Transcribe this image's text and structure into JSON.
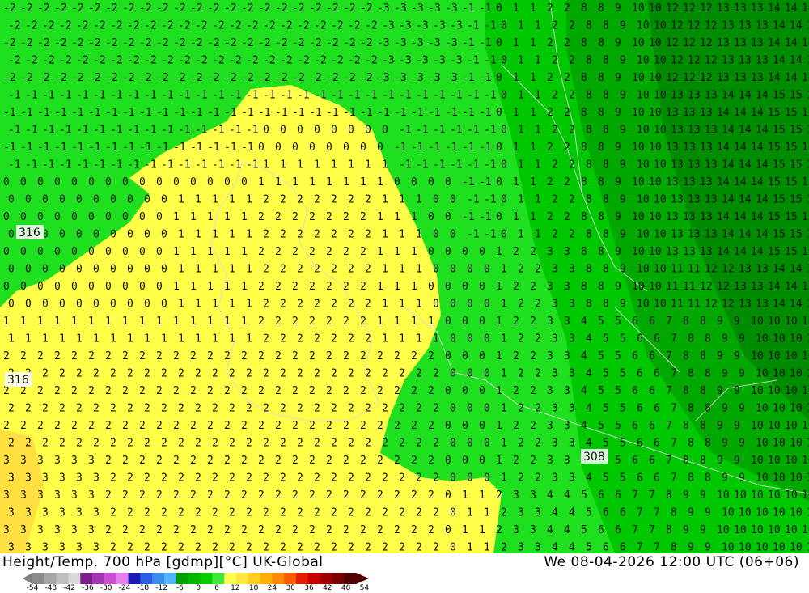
{
  "footer": {
    "title": "Height/Temp. 700 hPa [gdmp][°C] UK-Global",
    "date": "We 08-04-2026 12:00 UTC (06+06)"
  },
  "height_labels": [
    "316",
    "316",
    "308"
  ],
  "colorbar": {
    "ticks": [
      "-54",
      "-48",
      "-42",
      "-36",
      "-30",
      "-24",
      "-18",
      "-12",
      "-6",
      "0",
      "6",
      "12",
      "18",
      "24",
      "30",
      "36",
      "42",
      "48",
      "54"
    ],
    "colors": [
      "#8c8c8c",
      "#a6a6a6",
      "#c0c0c0",
      "#d9d9d9",
      "#7a1f8c",
      "#a336b5",
      "#c84fd6",
      "#e87ef0",
      "#1a1ab8",
      "#2d5be6",
      "#3c8cf0",
      "#52b4ff",
      "#00a000",
      "#00b800",
      "#00d000",
      "#3ce83c",
      "#ffff50",
      "#ffe83c",
      "#ffd020",
      "#ffb000",
      "#ff8c00",
      "#ff5a00",
      "#e61e00",
      "#c80000",
      "#a00000",
      "#780000",
      "#500000"
    ]
  },
  "map": {
    "contour_colors": {
      "yellow": "#ffff4a",
      "green_light": "#1fe01f",
      "green_mid": "#00c800",
      "green_dark": "#00a800",
      "green_darker": "#008c00",
      "orange_light": "#ffe040"
    }
  }
}
